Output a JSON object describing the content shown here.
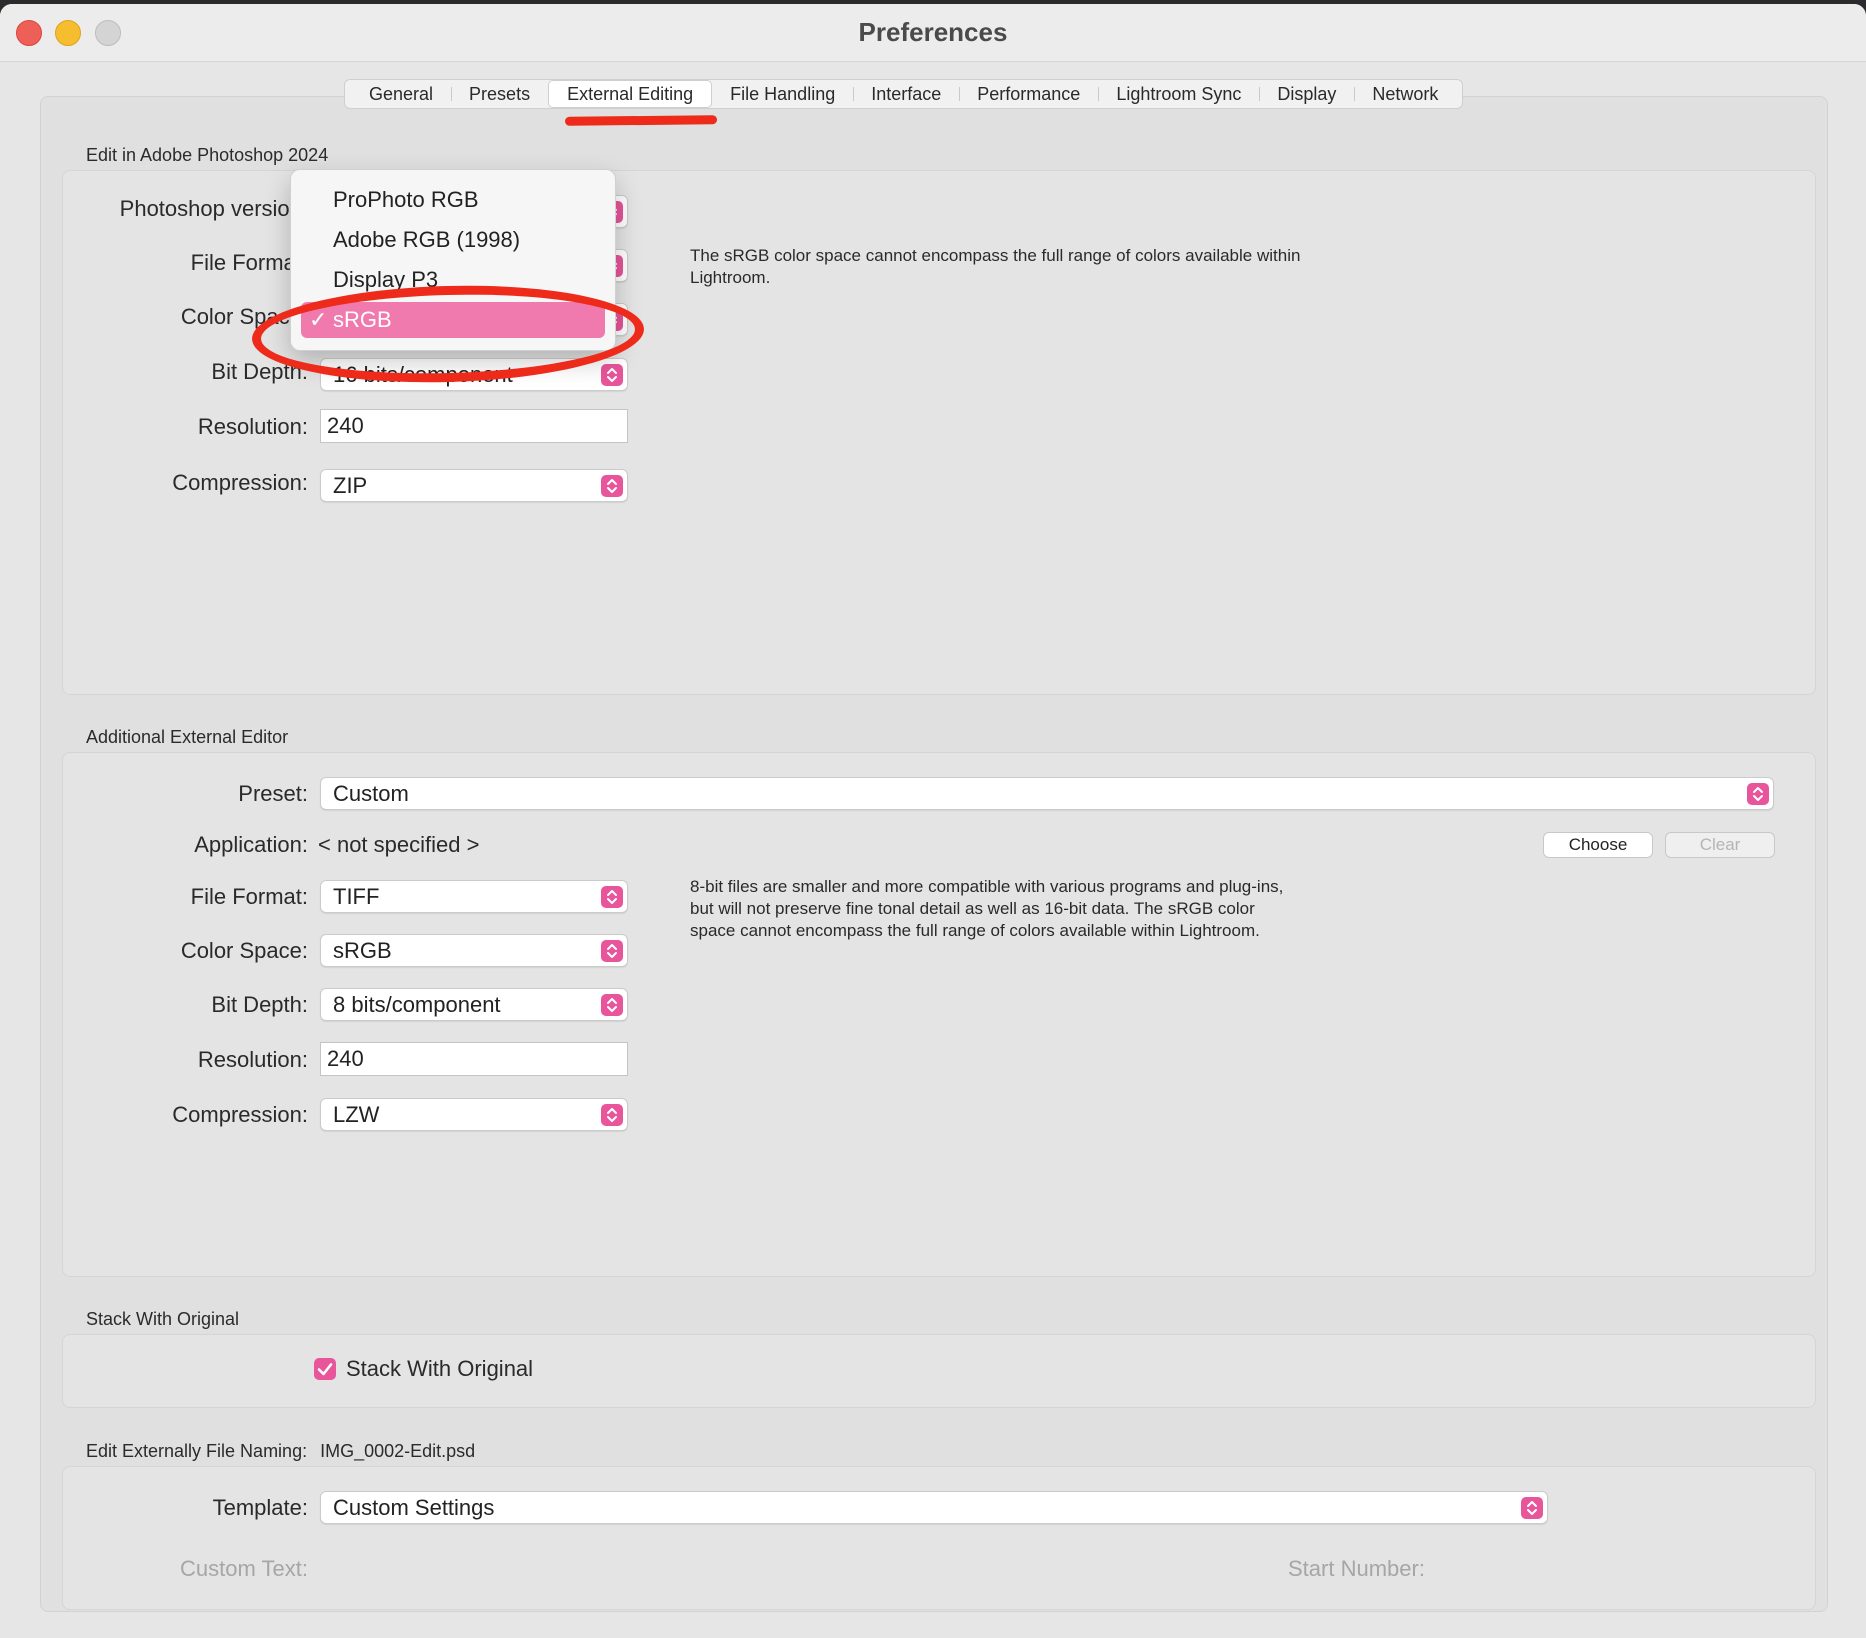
{
  "window": {
    "title": "Preferences"
  },
  "tabs": [
    {
      "label": "General"
    },
    {
      "label": "Presets"
    },
    {
      "label": "External Editing"
    },
    {
      "label": "File Handling"
    },
    {
      "label": "Interface"
    },
    {
      "label": "Performance"
    },
    {
      "label": "Lightroom Sync"
    },
    {
      "label": "Display"
    },
    {
      "label": "Network"
    }
  ],
  "photoshop": {
    "section_label": "Edit in Adobe Photoshop 2024",
    "version_label": "Photoshop version:",
    "file_format_label": "File Format:",
    "color_space_label": "Color Space:",
    "bit_depth_label": "Bit Depth:",
    "bit_depth_value": "16 bits/component",
    "resolution_label": "Resolution:",
    "resolution_value": "240",
    "compression_label": "Compression:",
    "compression_value": "ZIP",
    "note": "The sRGB color space cannot encompass the full range of colors available within Lightroom."
  },
  "color_space_menu": {
    "options": [
      "ProPhoto RGB",
      "Adobe RGB (1998)",
      "Display P3",
      "sRGB"
    ],
    "selected": "sRGB",
    "check_glyph": "✓"
  },
  "additional_editor": {
    "section_label": "Additional External Editor",
    "preset_label": "Preset:",
    "preset_value": "Custom",
    "application_label": "Application:",
    "application_value": "< not specified >",
    "choose_button": "Choose",
    "clear_button": "Clear",
    "file_format_label": "File Format:",
    "file_format_value": "TIFF",
    "color_space_label": "Color Space:",
    "color_space_value": "sRGB",
    "bit_depth_label": "Bit Depth:",
    "bit_depth_value": "8 bits/component",
    "resolution_label": "Resolution:",
    "resolution_value": "240",
    "compression_label": "Compression:",
    "compression_value": "LZW",
    "note": "8-bit files are smaller and more compatible with various programs and plug-ins, but will not preserve fine tonal detail as well as 16-bit data. The sRGB color space cannot encompass the full range of colors available within Lightroom."
  },
  "stack": {
    "section_label": "Stack With Original",
    "checkbox_label": "Stack With Original",
    "checked": true
  },
  "naming": {
    "section_label": "Edit Externally File Naming:",
    "example": "IMG_0002-Edit.psd",
    "template_label": "Template:",
    "template_value": "Custom Settings",
    "custom_text_label": "Custom Text:",
    "start_number_label": "Start Number:"
  },
  "colors": {
    "accent": "#e8559a",
    "menu_highlight": "#f07aae",
    "annotation_red": "#ee2a1b"
  }
}
